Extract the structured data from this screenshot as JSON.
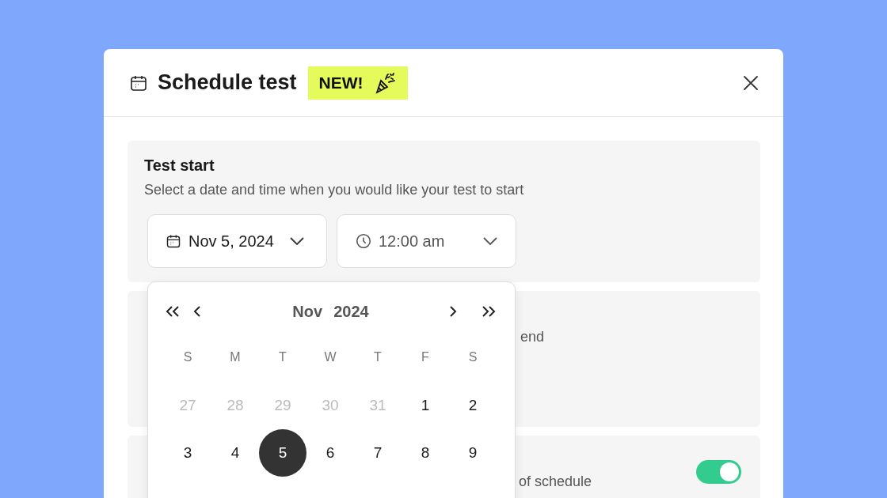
{
  "dialog": {
    "title": "Schedule test",
    "badge": "NEW!"
  },
  "sections": [
    {
      "kind": "start",
      "title": "Test start",
      "description": "Select a date and time when you would like your test to start",
      "date": "Nov 5, 2024",
      "time": "12:00 am"
    },
    {
      "kind": "text",
      "fragment": "end"
    },
    {
      "kind": "toggle",
      "fragment": "of schedule",
      "on": true
    }
  ],
  "calendar": {
    "month": "Nov",
    "year": "2024",
    "weekdays": [
      "S",
      "M",
      "T",
      "W",
      "T",
      "F",
      "S"
    ],
    "weeks": [
      [
        {
          "label": "27",
          "outside": true,
          "selected": false
        },
        {
          "label": "28",
          "outside": true,
          "selected": false
        },
        {
          "label": "29",
          "outside": true,
          "selected": false
        },
        {
          "label": "30",
          "outside": true,
          "selected": false
        },
        {
          "label": "31",
          "outside": true,
          "selected": false
        },
        {
          "label": "1",
          "outside": false,
          "selected": false
        },
        {
          "label": "2",
          "outside": false,
          "selected": false
        }
      ],
      [
        {
          "label": "3",
          "outside": false,
          "selected": false
        },
        {
          "label": "4",
          "outside": false,
          "selected": false
        },
        {
          "label": "5",
          "outside": false,
          "selected": true
        },
        {
          "label": "6",
          "outside": false,
          "selected": false
        },
        {
          "label": "7",
          "outside": false,
          "selected": false
        },
        {
          "label": "8",
          "outside": false,
          "selected": false
        },
        {
          "label": "9",
          "outside": false,
          "selected": false
        }
      ]
    ]
  }
}
